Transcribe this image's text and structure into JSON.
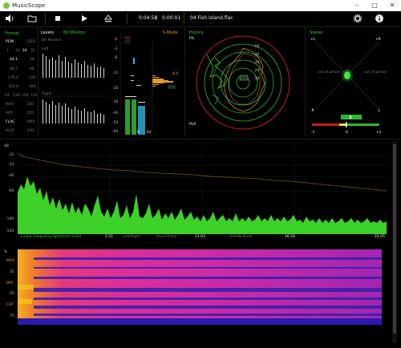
{
  "app": {
    "title": "MusicScope"
  },
  "toolbar": {
    "elapsed": "0:04:58",
    "separator": "/",
    "remaining": "0:00:01",
    "track": "04 Fish Island.flac"
  },
  "format": {
    "title": "Format",
    "pcm": "PCM",
    "dsd": "DSD",
    "bits": [
      "1",
      "16",
      "24",
      "32"
    ],
    "rates": [
      [
        "44.1",
        "48"
      ],
      [
        "88.2",
        "96"
      ],
      [
        "176.4",
        "192"
      ],
      [
        "352.8",
        "384"
      ]
    ],
    "dsd_rates": [
      "64",
      "128",
      "256",
      "512"
    ],
    "codecs": [
      [
        "WAV",
        "DSF"
      ],
      [
        "AIFF",
        "DFF"
      ],
      [
        "FLAC",
        "MP3"
      ],
      [
        "ALAC",
        "AAC"
      ]
    ]
  },
  "levels": {
    "title": "Levels",
    "bitmonitor_label": "Bit Monitor",
    "bitmonitor_sub": "Bit Monitor",
    "left": "Left",
    "right": "Right",
    "smode": "S-Mode",
    "scale": [
      "0",
      "-3",
      "-6",
      "-12",
      "-20",
      "-30",
      "-40",
      "-50",
      "-60"
    ],
    "peak": "8.9",
    "meter_labels": [
      "R",
      "LU"
    ]
  },
  "history": {
    "title": "History",
    "pl": "P/L",
    "plr": "PLR",
    "rings": [
      "-10",
      "-20",
      "-30",
      "-40",
      "-50"
    ]
  },
  "stereo": {
    "title": "Stereo",
    "l_plus": "+L",
    "r_plus": "+R",
    "l_minus": "-L",
    "r_minus": "-R",
    "oop_left": "out of phase",
    "oop_right": "out of phase",
    "corr": [
      "-1",
      "0",
      "+1"
    ]
  },
  "spectrum": {
    "unit": "dB",
    "y_labels": [
      "-12",
      "-24",
      "-40",
      "-60",
      "-100",
      "-144"
    ],
    "bottom_labels": [
      "Linear Frequency Spectrum [kHz]",
      "5.51",
      "Left/Right",
      "Pans/Phase",
      "11.03",
      "-200dB Mode",
      "16.54",
      "22.05"
    ]
  },
  "spectrogram": {
    "unit": "%",
    "labels": [
      "MAX",
      "25",
      "BRY",
      "50",
      "CXF",
      "75"
    ]
  }
}
